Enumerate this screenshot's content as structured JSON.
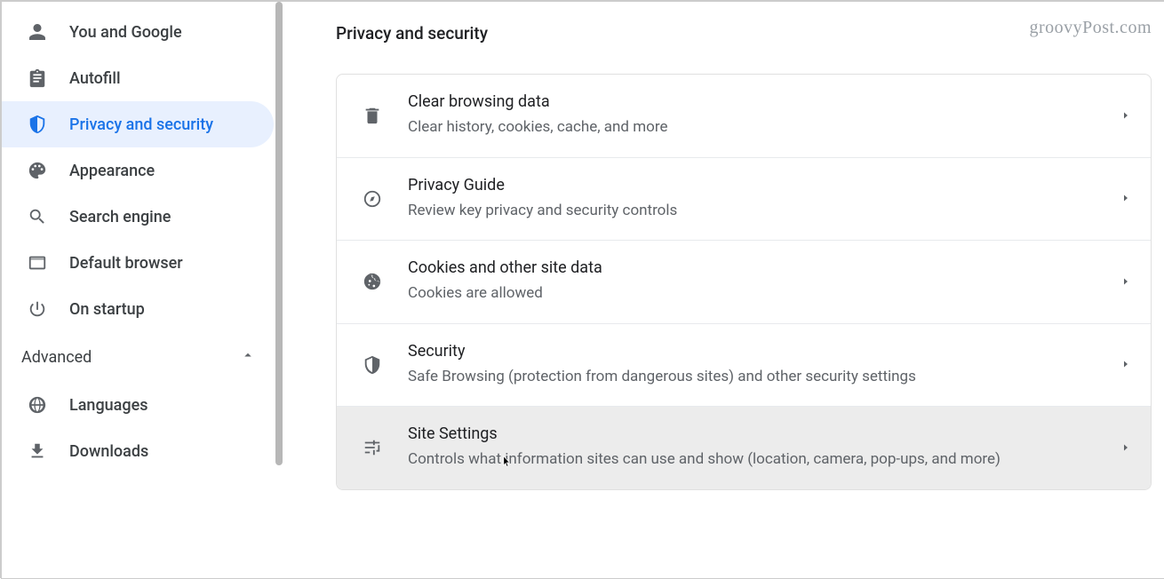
{
  "watermark": "groovyPost.com",
  "sidebar": {
    "items": [
      {
        "label": "You and Google"
      },
      {
        "label": "Autofill"
      },
      {
        "label": "Privacy and security"
      },
      {
        "label": "Appearance"
      },
      {
        "label": "Search engine"
      },
      {
        "label": "Default browser"
      },
      {
        "label": "On startup"
      }
    ],
    "advanced_label": "Advanced",
    "adv_items": [
      {
        "label": "Languages"
      },
      {
        "label": "Downloads"
      }
    ]
  },
  "page_title": "Privacy and security",
  "rows": [
    {
      "title": "Clear browsing data",
      "sub": "Clear history, cookies, cache, and more"
    },
    {
      "title": "Privacy Guide",
      "sub": "Review key privacy and security controls"
    },
    {
      "title": "Cookies and other site data",
      "sub": "Cookies are allowed"
    },
    {
      "title": "Security",
      "sub": "Safe Browsing (protection from dangerous sites) and other security settings"
    },
    {
      "title": "Site Settings",
      "sub": "Controls what information sites can use and show (location, camera, pop-ups, and more)"
    }
  ]
}
